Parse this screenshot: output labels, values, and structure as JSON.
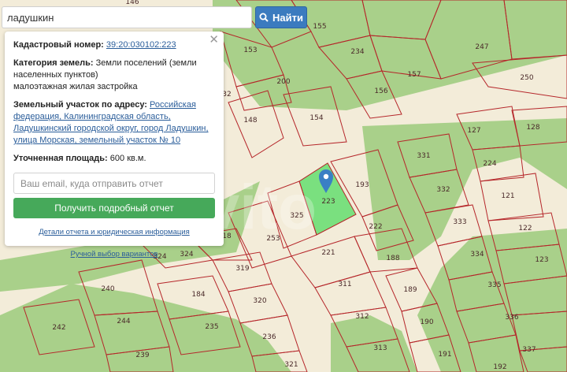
{
  "search": {
    "value": "ладушкин",
    "button_label": "Найти",
    "icon": "search-icon"
  },
  "panel": {
    "close_glyph": "✕",
    "cadastral_label": "Кадастровый номер:",
    "cadastral_value": "39:20:030102:223",
    "category_label": "Категория земель:",
    "category_value": "Земли поселений (земли населенных пунктов)",
    "category_sub": "малоэтажная жилая застройка",
    "address_label": "Земельный участок по адресу:",
    "address_value": "Российская федерация, Калининградская область, Ладушкинский городской округ, город Ладушкин, улица Морская, земельный участок № 10",
    "area_label": "Уточненная площадь:",
    "area_value": "600 кв.м.",
    "email_placeholder": "Ваш email, куда отправить отчет",
    "report_button": "Получить подробный отчет",
    "details_link": "Детали отчета и юридическая информация",
    "manual_link": "Ручной выбор вариантов"
  },
  "map": {
    "colors": {
      "background": "#f3ecd9",
      "green_area": "#a9d08a",
      "parcel_border": "#b5262a",
      "selected_fill": "#7ae07f",
      "marker": "#3a7fc4"
    },
    "selected_parcel": "223",
    "watermark": "Avito",
    "parcel_labels": [
      "146",
      "155",
      "247",
      "153",
      "234",
      "157",
      "250",
      "200",
      "156",
      "32",
      "148",
      "154",
      "127",
      "128",
      "331",
      "224",
      "193",
      "332",
      "121",
      "223",
      "325",
      "222",
      "333",
      "122",
      "253",
      "221",
      "188",
      "334",
      "123",
      "18",
      "324",
      "324",
      "319",
      "311",
      "189",
      "335",
      "240",
      "184",
      "320",
      "190",
      "336",
      "244",
      "235",
      "312",
      "242",
      "236",
      "313",
      "191",
      "337",
      "239",
      "321",
      "192"
    ]
  }
}
